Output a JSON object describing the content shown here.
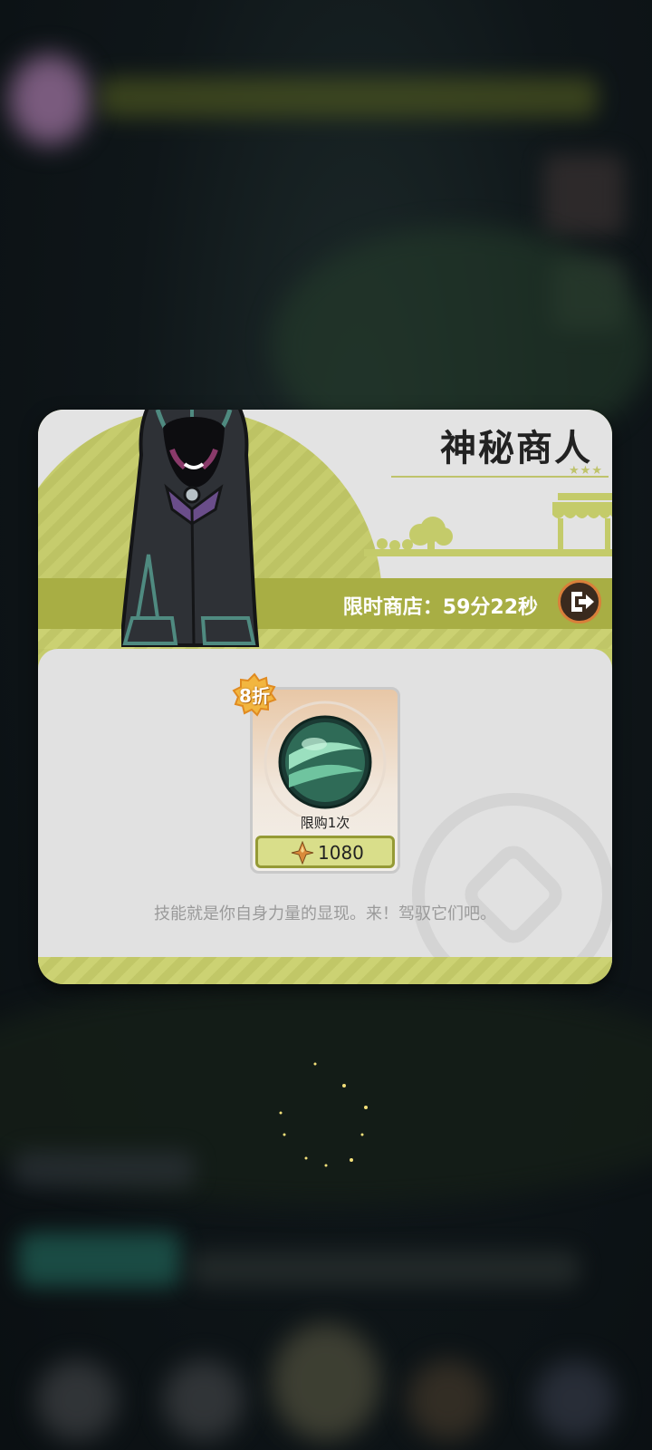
{
  "colors": {
    "accent": "#c4cb6a",
    "band": "#a8ae44",
    "panel": "#e1e1e1",
    "exit_border": "#d97f3a"
  },
  "shop": {
    "title": "神秘商人",
    "title_stars": "★★★",
    "timer": "限时商店：59分22秒",
    "exit_icon": "exit-door-icon",
    "description": "技能就是你自身力量的显现。来！驾驭它们吧。"
  },
  "item": {
    "icon": "skill-orb-icon",
    "discount": "8折",
    "limit_text": "限购1次",
    "currency_icon": "crystal-icon",
    "price": "1080"
  }
}
